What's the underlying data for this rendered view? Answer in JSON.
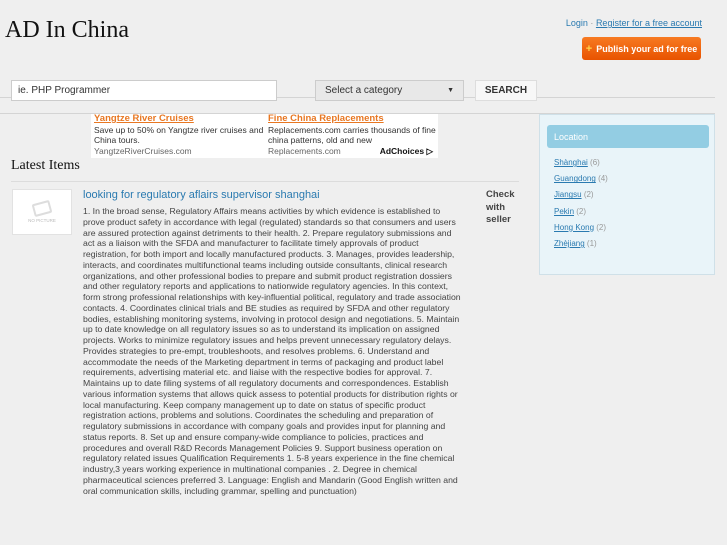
{
  "site_title": "AD In China",
  "header": {
    "login": "Login",
    "separator": "·",
    "register": "Register for a free account",
    "publish": "Publish your ad for free",
    "publish_icon": "+"
  },
  "search": {
    "placeholder": "ie. PHP Programmer",
    "category": "Select a category",
    "button": "SEARCH"
  },
  "ads": [
    {
      "title": "Yangtze River Cruises",
      "text": "Save up to 50% on Yangtze river cruises and China tours.",
      "url": "YangtzeRiverCruises.com"
    },
    {
      "title": "Fine China Replacements",
      "text": "Replacements.com carries thousands of fine china patterns, old and new",
      "url": "Replacements.com"
    }
  ],
  "adchoices": "AdChoices ▷",
  "latest_heading": "Latest Items",
  "item": {
    "thumb": "NO PICTURE",
    "title": "looking for regulatory aflairs supervisor shanghai",
    "description": "1. In the broad sense, Regulatory Affairs means activities by which evidence is established to prove product safety in accordance with legal (regulated) standards so that consumers and users are assured protection against detriments to their health. 2. Prepare regulatory submissions and act as a liaison with the SFDA and manufacturer to facilitate timely approvals of product registration, for both import and locally manufactured products. 3. Manages, provides leadership, interacts, and coordinates multifunctional teams including outside consultants, clinical research organizations, and other professional bodies to prepare and submit product registration dossiers and other regulatory reports and applications to nationwide regulatory agencies. In this context, form strong professional relationships with key-influential political, regulatory and trade association contacts. 4. Coordinates clinical trials and BE studies as required by SFDA and other regulatory bodies, establishing monitoring systems, involving in protocol design and negotiations. 5. Maintain up to date knowledge on all regulatory issues so as to understand its implication on assigned projects. Works to minimize regulatory issues and helps prevent unnecessary regulatory delays. Provides strategies to pre-empt, troubleshoots, and resolves problems. 6. Understand and accommodate the needs of the Marketing department in terms of packaging and product label requirements, advertising material etc. and liaise with the respective bodies for approval. 7. Maintains up to date filing systems of all regulatory documents and correspondences. Establish various information systems that allows quick assess to potential products for distribution rights or local manufacturing. Keep company management up to date on status of specific product registration actions, problems and solutions. Coordinates the scheduling and preparation of regulatory submissions in accordance with company goals and provides input for planning and status reports. 8. Set up and ensure company-wide compliance to policies, practices and procedures and overall R&D Records Management Policies 9. Support business operation on regulatory related issues Qualification Requirements  1. 5-8 years experience in the fine chemical industry,3 years working experience in multinational companies . 2. Degree in chemical pharmaceutical sciences preferred 3. Language: English and Mandarin (Good English written and oral communication skills, including grammar, spelling and punctuation)",
    "price": "Check with seller"
  },
  "sidebar": {
    "heading": "Location",
    "locations": [
      {
        "name": "Shànghai",
        "count": "(6)"
      },
      {
        "name": "Guangdong",
        "count": "(4)"
      },
      {
        "name": "Jiangsu",
        "count": "(2)"
      },
      {
        "name": "Pekin",
        "count": "(2)"
      },
      {
        "name": "Hong Kong",
        "count": "(2)"
      },
      {
        "name": "Zhèjiang",
        "count": "(1)"
      }
    ]
  }
}
